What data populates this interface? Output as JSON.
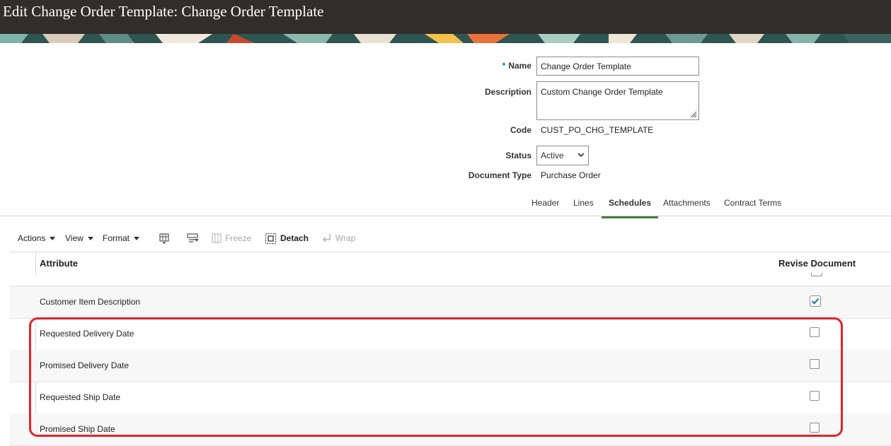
{
  "page": {
    "title": "Edit Change Order Template: Change Order Template"
  },
  "form": {
    "name_label": "Name",
    "required_marker": "*",
    "name_value": "Change Order Template",
    "description_label": "Description",
    "description_value": "Custom Change Order Template",
    "code_label": "Code",
    "code_value": "CUST_PO_CHG_TEMPLATE",
    "status_label": "Status",
    "status_value": "Active",
    "document_type_label": "Document Type",
    "document_type_value": "Purchase Order"
  },
  "tabs": [
    {
      "label": "Header"
    },
    {
      "label": "Lines"
    },
    {
      "label": "Schedules",
      "active": true
    },
    {
      "label": "Attachments"
    },
    {
      "label": "Contract Terms"
    }
  ],
  "toolbar": {
    "actions": "Actions",
    "view": "View",
    "format": "Format",
    "freeze": "Freeze",
    "detach": "Detach",
    "wrap": "Wrap",
    "icons": [
      "columns-icon",
      "query-by-example-icon",
      "freeze-icon",
      "detach-icon",
      "wrap-icon"
    ]
  },
  "table": {
    "columns": [
      "Attribute",
      "Revise Document"
    ],
    "rows": [
      {
        "attribute": "Customer Item Description",
        "revise": true
      },
      {
        "attribute": "Requested Delivery Date",
        "revise": false
      },
      {
        "attribute": "Promised Delivery Date",
        "revise": false
      },
      {
        "attribute": "Requested Ship Date",
        "revise": false
      },
      {
        "attribute": "Promised Ship Date",
        "revise": false
      }
    ]
  },
  "colors": {
    "accent": "#1f6fb5",
    "highlight": "#e0242c",
    "tab_active": "#4a7a3f",
    "titlebar": "#312d2a"
  }
}
